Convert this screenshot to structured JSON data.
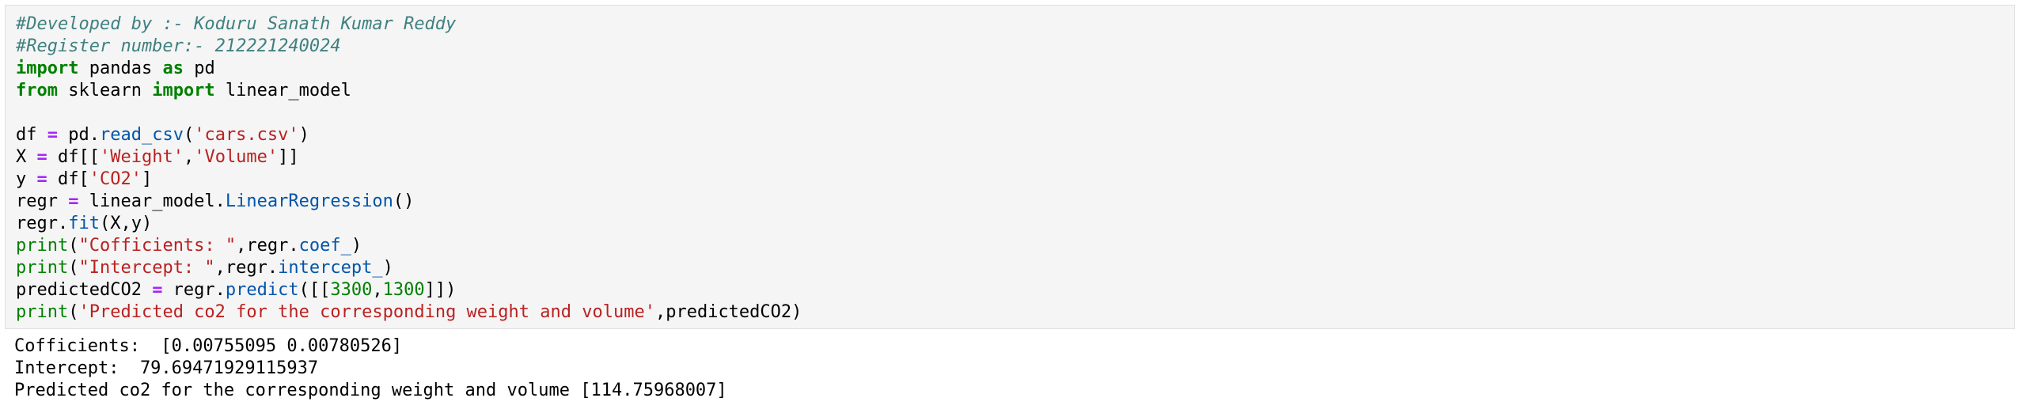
{
  "cell": {
    "code_lines": [
      [
        {
          "t": "#Developed by :- Koduru Sanath Kumar Reddy",
          "c": "cm"
        }
      ],
      [
        {
          "t": "#Register number:- 212221240024",
          "c": "cm"
        }
      ],
      [
        {
          "t": "import",
          "c": "kw"
        },
        {
          "t": " pandas ",
          "c": ""
        },
        {
          "t": "as",
          "c": "kw"
        },
        {
          "t": " pd",
          "c": ""
        }
      ],
      [
        {
          "t": "from",
          "c": "kw"
        },
        {
          "t": " sklearn ",
          "c": ""
        },
        {
          "t": "import",
          "c": "kw"
        },
        {
          "t": " linear_model",
          "c": ""
        }
      ],
      [],
      [
        {
          "t": "df ",
          "c": ""
        },
        {
          "t": "=",
          "c": "op"
        },
        {
          "t": " pd.",
          "c": ""
        },
        {
          "t": "read_csv",
          "c": "fn"
        },
        {
          "t": "(",
          "c": ""
        },
        {
          "t": "'cars.csv'",
          "c": "st"
        },
        {
          "t": ")",
          "c": ""
        }
      ],
      [
        {
          "t": "X ",
          "c": ""
        },
        {
          "t": "=",
          "c": "op"
        },
        {
          "t": " df[[",
          "c": ""
        },
        {
          "t": "'Weight'",
          "c": "st"
        },
        {
          "t": ",",
          "c": ""
        },
        {
          "t": "'Volume'",
          "c": "st"
        },
        {
          "t": "]]",
          "c": ""
        }
      ],
      [
        {
          "t": "y ",
          "c": ""
        },
        {
          "t": "=",
          "c": "op"
        },
        {
          "t": " df[",
          "c": ""
        },
        {
          "t": "'CO2'",
          "c": "st"
        },
        {
          "t": "]",
          "c": ""
        }
      ],
      [
        {
          "t": "regr ",
          "c": ""
        },
        {
          "t": "=",
          "c": "op"
        },
        {
          "t": " linear_model.",
          "c": ""
        },
        {
          "t": "LinearRegression",
          "c": "fn"
        },
        {
          "t": "()",
          "c": ""
        }
      ],
      [
        {
          "t": "regr.",
          "c": ""
        },
        {
          "t": "fit",
          "c": "fn"
        },
        {
          "t": "(X,y)",
          "c": ""
        }
      ],
      [
        {
          "t": "print",
          "c": "nm"
        },
        {
          "t": "(",
          "c": ""
        },
        {
          "t": "\"Cofficients: \"",
          "c": "st"
        },
        {
          "t": ",regr.",
          "c": ""
        },
        {
          "t": "coef_",
          "c": "fn"
        },
        {
          "t": ")",
          "c": ""
        }
      ],
      [
        {
          "t": "print",
          "c": "nm"
        },
        {
          "t": "(",
          "c": ""
        },
        {
          "t": "\"Intercept: \"",
          "c": "st"
        },
        {
          "t": ",regr.",
          "c": ""
        },
        {
          "t": "intercept_",
          "c": "fn"
        },
        {
          "t": ")",
          "c": ""
        }
      ],
      [
        {
          "t": "predictedCO2 ",
          "c": ""
        },
        {
          "t": "=",
          "c": "op"
        },
        {
          "t": " regr.",
          "c": ""
        },
        {
          "t": "predict",
          "c": "fn"
        },
        {
          "t": "([[",
          "c": ""
        },
        {
          "t": "3300",
          "c": "nm"
        },
        {
          "t": ",",
          "c": ""
        },
        {
          "t": "1300",
          "c": "nm"
        },
        {
          "t": "]])",
          "c": ""
        }
      ],
      [
        {
          "t": "print",
          "c": "nm"
        },
        {
          "t": "(",
          "c": ""
        },
        {
          "t": "'Predicted co2 for the corresponding weight and volume'",
          "c": "st"
        },
        {
          "t": ",predictedCO2)",
          "c": ""
        }
      ]
    ],
    "output_lines": [
      "Cofficients:  [0.00755095 0.00780526]",
      "Intercept:  79.69471929115937",
      "Predicted co2 for the corresponding weight and volume [114.75968007]"
    ]
  },
  "colors": {
    "cell_background": "#f5f5f5",
    "comment": "#408080",
    "keyword": "#008000",
    "operator": "#aa22ff",
    "string": "#ba2121",
    "function": "#0055aa"
  }
}
